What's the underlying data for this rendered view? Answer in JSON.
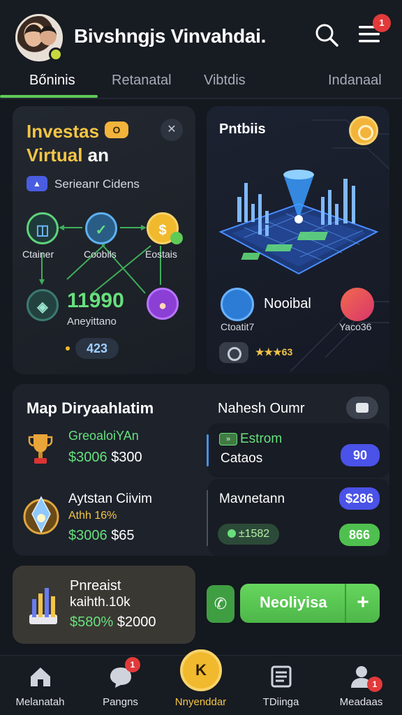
{
  "header": {
    "title": "Bivshngjs Vinvahdai.",
    "menu_badge": "1"
  },
  "tabs": [
    {
      "label": "Bőninis",
      "active": true
    },
    {
      "label": "Retanatal",
      "active": false
    },
    {
      "label": "Vibtdis",
      "active": false
    },
    {
      "label": "Indanaal",
      "active": false
    }
  ],
  "card1": {
    "title_line1": "Investas",
    "title_line2_a": "Virtual",
    "title_line2_b": "an",
    "coin_badge": "O",
    "chip_text": "Serieanr Cidens",
    "nodes": [
      {
        "label": "Ctainer"
      },
      {
        "label": "Coobils"
      },
      {
        "label": "Eostais"
      }
    ],
    "big_number": "11990",
    "sub_label": "Aneyittano",
    "pill_number": "423"
  },
  "card2": {
    "title": "Pntbiis",
    "middle_label": "Nooibal",
    "left_label": "Ctoatit7",
    "right_label": "Yaco36",
    "rating": "★★★63"
  },
  "card3": {
    "title": "Map Diryaahlatim",
    "right_title": "Nahesh Oumr",
    "item1": {
      "label": "GreoaloiYAn",
      "value_green": "$3006",
      "value_white": "$300"
    },
    "item2": {
      "label": "Aytstan Ciivim",
      "sub_label": "Athh 16%",
      "value_green": "$3006",
      "value_white": "$65"
    },
    "sub1": {
      "icon_text": "»",
      "label": "Estrom",
      "sub_label": "Cataos",
      "badge": "90"
    },
    "sub2": {
      "label": "Mavnetann",
      "badge": "$286",
      "pill": "±1582",
      "badge2": "866"
    }
  },
  "card4": {
    "line1": "Pnreaist",
    "line2": "kaihth.10k",
    "value_green": "$580%",
    "value_white": "$2000"
  },
  "actions": {
    "main_button": "Neoliyisa",
    "plus": "+"
  },
  "bottom_nav": [
    {
      "label": "Melanatah",
      "icon": "home-icon",
      "badge": ""
    },
    {
      "label": "Pangns",
      "icon": "chat-icon",
      "badge": "1"
    },
    {
      "label": "Nnyenddar",
      "icon": "center-x-icon",
      "badge": "",
      "active": true
    },
    {
      "label": "TDiinga",
      "icon": "list-icon",
      "badge": ""
    },
    {
      "label": "Meadaas",
      "icon": "user-icon",
      "badge": "1"
    }
  ],
  "colors": {
    "accent_green": "#5ecb57",
    "accent_yellow": "#f4c545",
    "accent_blue": "#4a52e8",
    "background": "#14181f"
  }
}
